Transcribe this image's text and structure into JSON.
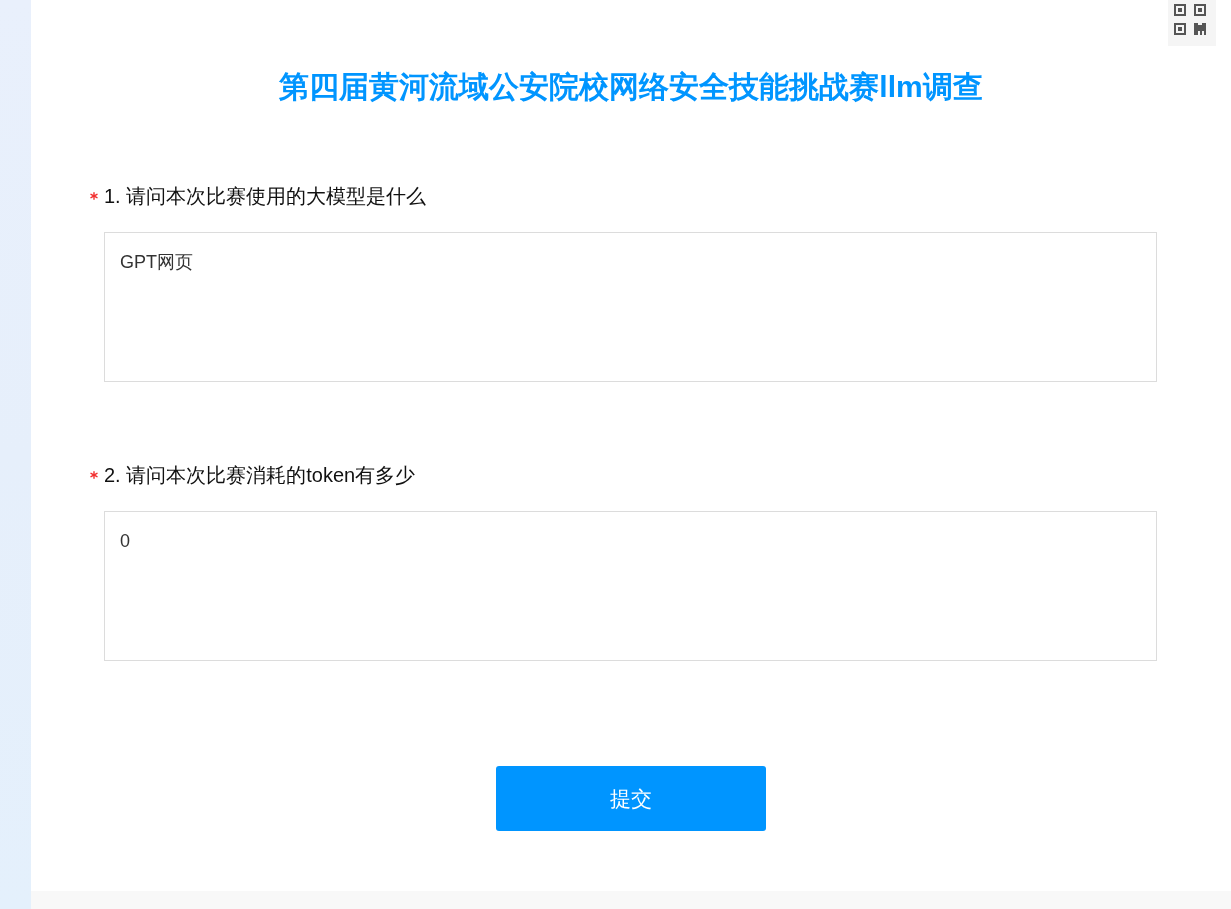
{
  "title": "第四届黄河流域公安院校网络安全技能挑战赛llm调查",
  "questions": [
    {
      "label": "1. 请问本次比赛使用的大模型是什么",
      "required": true,
      "answer": "GPT网页"
    },
    {
      "label": "2. 请问本次比赛消耗的token有多少",
      "required": true,
      "answer": "0"
    }
  ],
  "submit_button": "提交"
}
